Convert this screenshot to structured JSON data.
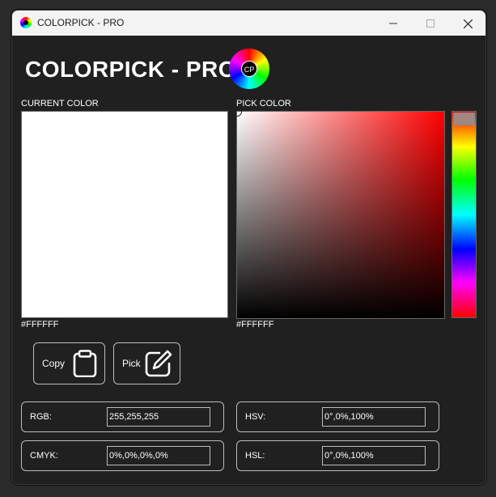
{
  "window": {
    "title": "COLORPICK - PRO"
  },
  "header": {
    "title": "COLORPICK - PRO",
    "logo_text": "CP"
  },
  "current": {
    "label": "CURRENT COLOR",
    "hex": "#FFFFFF",
    "swatch_color": "#FFFFFF"
  },
  "picker": {
    "label": "PICK COLOR",
    "hex": "#FFFFFF",
    "hue_color": "#FF0000"
  },
  "actions": {
    "copy_label": "Copy",
    "pick_label": "Pick"
  },
  "fields": {
    "rgb_label": "RGB:",
    "rgb_value": "255,255,255",
    "hsv_label": "HSV:",
    "hsv_value": "0°,0%,100%",
    "cmyk_label": "CMYK:",
    "cmyk_value": "0%,0%,0%,0%",
    "hsl_label": "HSL:",
    "hsl_value": "0°,0%,100%"
  },
  "icons": {
    "app": "color-wheel-icon",
    "minimize": "minimize-icon",
    "maximize": "maximize-icon",
    "close": "close-icon",
    "copy": "clipboard-icon",
    "pick": "edit-icon"
  }
}
